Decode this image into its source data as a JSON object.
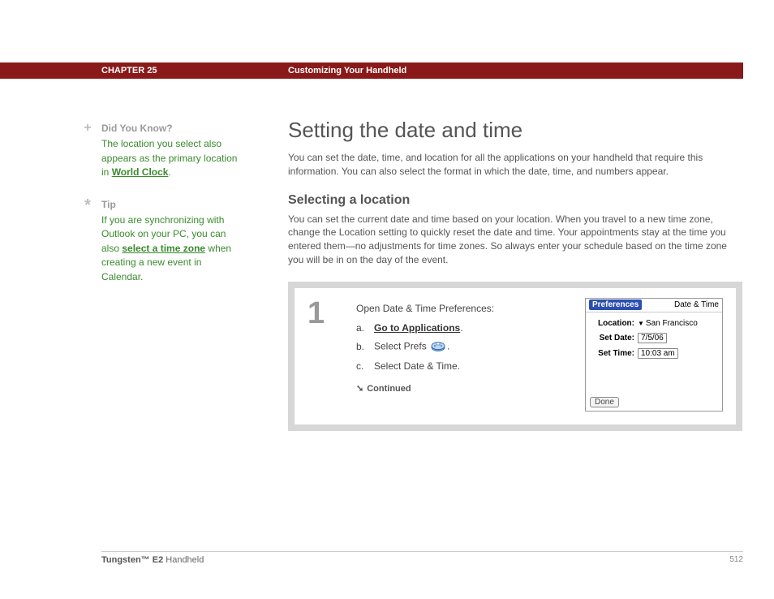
{
  "header": {
    "chapter": "CHAPTER 25",
    "title": "Customizing Your Handheld"
  },
  "sidebar": {
    "dyk": {
      "heading": "Did You Know?",
      "text_before": "The location you select also appears as the primary location in ",
      "link": "World Clock",
      "text_after": "."
    },
    "tip": {
      "heading": "Tip",
      "text_before": "If you are synchronizing with Outlook on your PC, you can also ",
      "link": "select a time zone",
      "text_after": " when creating a new event in Calendar."
    }
  },
  "main": {
    "h1": "Setting the date and time",
    "intro": "You can set the date, time, and location for all the applications on your handheld that require this information. You can also select the format in which the date, time, and numbers appear.",
    "h2": "Selecting a location",
    "subintro": "You can set the current date and time based on your location. When you travel to a new time zone, change the Location setting to quickly reset the date and time. Your appointments stay at the time you entered them—no adjustments for time zones. So always enter your schedule based on the time zone you will be in on the day of the event."
  },
  "step": {
    "number": "1",
    "title": "Open Date & Time Preferences:",
    "a_letter": "a.",
    "a_link": "Go to Applications",
    "a_after": ".",
    "b_letter": "b.",
    "b_before": "Select Prefs ",
    "b_after": ".",
    "c_letter": "c.",
    "c_text": "Select Date & Time.",
    "continued": "Continued"
  },
  "preview": {
    "tab": "Preferences",
    "header_title": "Date & Time",
    "location_label": "Location:",
    "location_value": "San Francisco",
    "date_label": "Set Date:",
    "date_value": "7/5/06",
    "time_label": "Set Time:",
    "time_value": "10:03 am",
    "done": "Done"
  },
  "footer": {
    "product_bold": "Tungsten™ E2",
    "product_rest": " Handheld",
    "page": "512"
  }
}
